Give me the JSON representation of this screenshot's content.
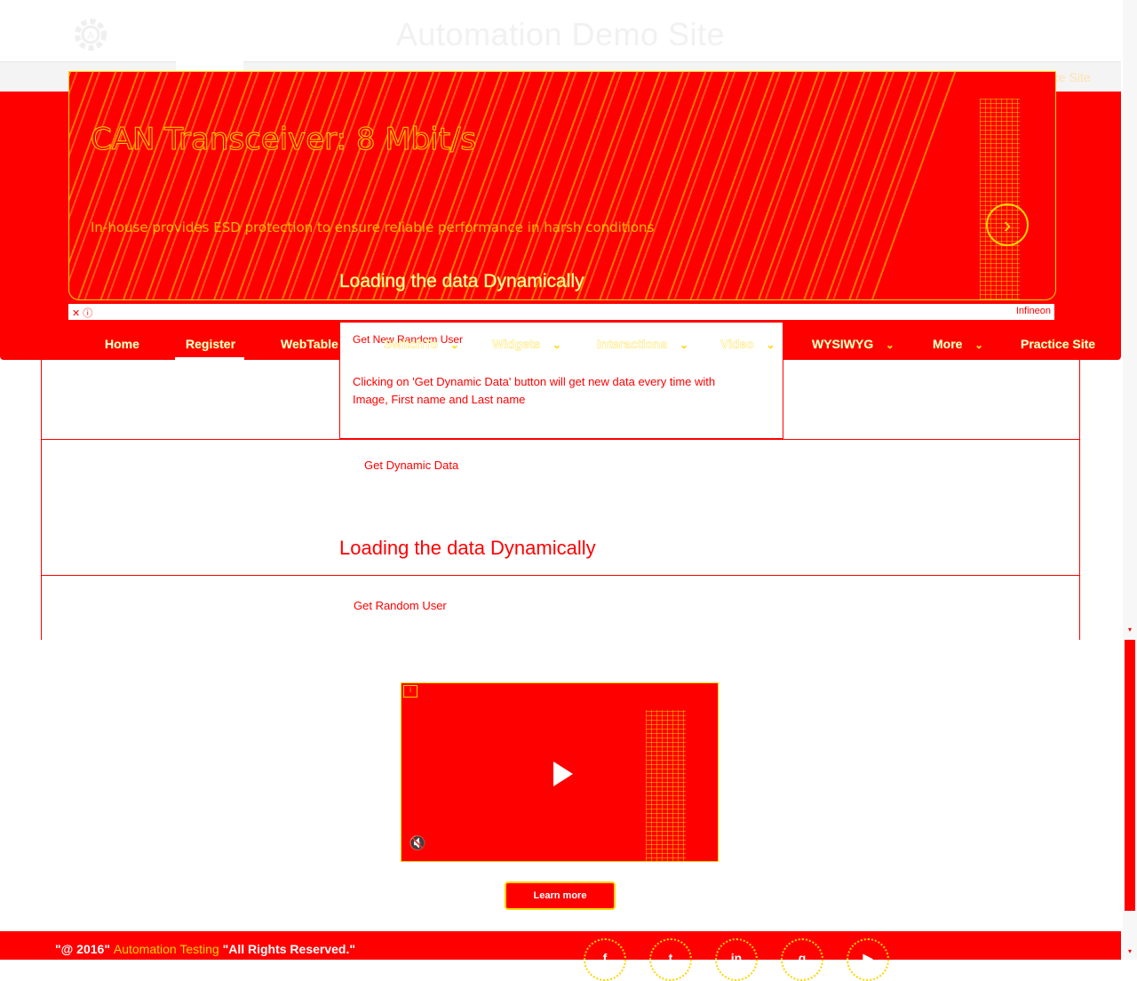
{
  "header": {
    "title": "Automation Demo Site",
    "logo_icon": "gear-logo-icon"
  },
  "nav": {
    "items": [
      {
        "label": "Home",
        "dropdown": false
      },
      {
        "label": "Register",
        "dropdown": false,
        "active": true
      },
      {
        "label": "WebTable",
        "dropdown": false
      },
      {
        "label": "SwitchTo",
        "dropdown": true
      },
      {
        "label": "Widgets",
        "dropdown": true
      },
      {
        "label": "Interactions",
        "dropdown": true
      },
      {
        "label": "Video",
        "dropdown": true
      },
      {
        "label": "WYSIWYG",
        "dropdown": true
      },
      {
        "label": "More",
        "dropdown": true
      },
      {
        "label": "Practice Site",
        "dropdown": false
      }
    ]
  },
  "ad": {
    "headline": "CAN Transceiver: 8 Mbit/s",
    "subtext": "In-house provides ESD protection to ensure reliable performance in harsh conditions",
    "cta_icon": "chevron-right-icon",
    "close_icon": "close-icon",
    "brand": "Infineon"
  },
  "overlay_heading": "Loading the data Dynamically",
  "card": {
    "title": "Get New Random User",
    "description": "Clicking on 'Get Dynamic Data' button will get new data every time with Image, First name and Last name"
  },
  "main": {
    "get_dynamic_button": "Get Dynamic Data",
    "heading": "Loading the data Dynamically",
    "random_user_label": "Get Random User"
  },
  "video": {
    "play_icon": "play-icon",
    "mute_icon": "mute-icon",
    "info_icon": "info-icon",
    "learn_more": "Learn more"
  },
  "footer": {
    "prefix": "\"@ 2016\"",
    "brand": "Automation Testing",
    "suffix": "\"All Rights Reserved.\"",
    "social": [
      {
        "name": "facebook-icon",
        "glyph": "f"
      },
      {
        "name": "twitter-icon",
        "glyph": "t"
      },
      {
        "name": "linkedin-icon",
        "glyph": "in"
      },
      {
        "name": "google-plus-icon",
        "glyph": "g"
      },
      {
        "name": "youtube-icon",
        "glyph": "▶"
      }
    ]
  },
  "colors": {
    "accent": "#ff0000",
    "highlight": "#ffd400",
    "background": "#ffffff"
  }
}
